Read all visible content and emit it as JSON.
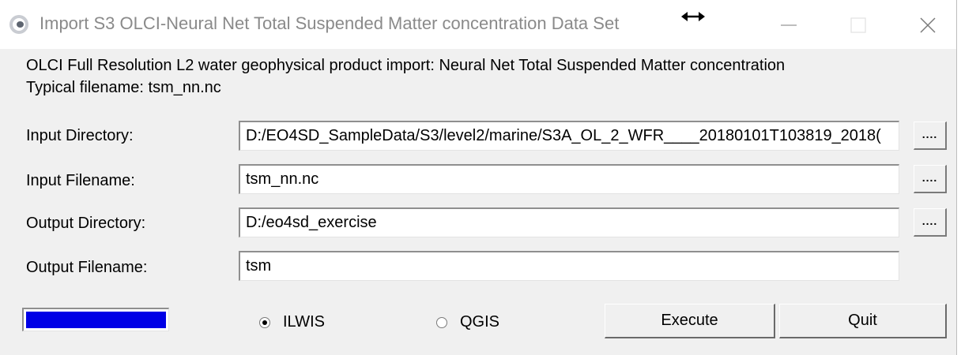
{
  "window": {
    "title": "Import S3 OLCI-Neural Net Total Suspended Matter concentration Data Set",
    "icon": "app-logo-icon",
    "controls": [
      "resize-cursor-icon",
      "minimize-icon",
      "maximize-icon",
      "close-icon"
    ]
  },
  "description": {
    "line1": "OLCI Full Resolution L2 water geophysical product import: Neural Net Total Suspended Matter concentration",
    "line2": "Typical filename: tsm_nn.nc"
  },
  "fields": {
    "input_directory": {
      "label": "Input Directory:",
      "value": "D:/EO4SD_SampleData/S3/level2/marine/S3A_OL_2_WFR____20180101T103819_2018(",
      "browse_label": "...."
    },
    "input_filename": {
      "label": "Input Filename:",
      "value": "tsm_nn.nc",
      "browse_label": "...."
    },
    "output_directory": {
      "label": "Output Directory:",
      "value": "D:/eo4sd_exercise",
      "browse_label": "...."
    },
    "output_filename": {
      "label": "Output Filename:",
      "value": "tsm"
    }
  },
  "progress": {
    "fraction": 1.0,
    "color": "#0000e6"
  },
  "format_options": {
    "selected": "ILWIS",
    "ilwis_label": "ILWIS",
    "qgis_label": "QGIS"
  },
  "buttons": {
    "execute_label": "Execute",
    "quit_label": "Quit"
  }
}
